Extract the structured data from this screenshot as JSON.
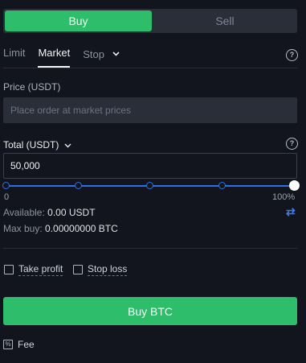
{
  "side_toggle": {
    "buy": "Buy",
    "sell": "Sell"
  },
  "order_tabs": {
    "limit": "Limit",
    "market": "Market",
    "stop": "Stop"
  },
  "price": {
    "label": "Price (USDT)",
    "placeholder": "Place order at market prices"
  },
  "total": {
    "label": "Total (USDT)",
    "value": "50,000"
  },
  "slider": {
    "min_label": "0",
    "max_label": "100%",
    "percent": 100
  },
  "balances": {
    "available_label": "Available:",
    "available_value": "0.00 USDT",
    "maxbuy_label": "Max buy:",
    "maxbuy_value": "0.00000000 BTC"
  },
  "options": {
    "take_profit": "Take profit",
    "stop_loss": "Stop loss"
  },
  "action": {
    "buy_button": "Buy BTC"
  },
  "fee": {
    "label": "Fee"
  },
  "colors": {
    "buy_green": "#2ebd6b",
    "slider_blue": "#2d6fe6",
    "background": "#12151d"
  }
}
